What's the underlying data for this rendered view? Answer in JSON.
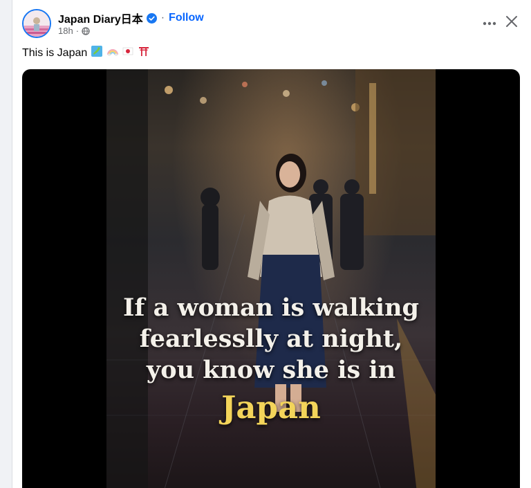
{
  "post": {
    "page_name": "Japan Diary日本",
    "follow_label": "Follow",
    "time": "18h",
    "caption_text": "This is Japan",
    "caption_emojis": [
      "map-of-japan-emoji",
      "rainbow-emoji",
      "japan-flag-emoji",
      "torii-gate-emoji"
    ],
    "image_text": {
      "line1": "If a woman is walking",
      "line2": "fearlesslly at night,",
      "line3": "you know she is in",
      "highlight": "Japan"
    }
  },
  "icons": {
    "verified": "verified-badge-icon",
    "privacy": "globe-icon",
    "more": "more-options-icon",
    "close": "close-icon"
  },
  "colors": {
    "accent": "#0866ff",
    "verified": "#1877f2",
    "secondary_text": "#65676b",
    "highlight_text": "#f3d45a"
  }
}
